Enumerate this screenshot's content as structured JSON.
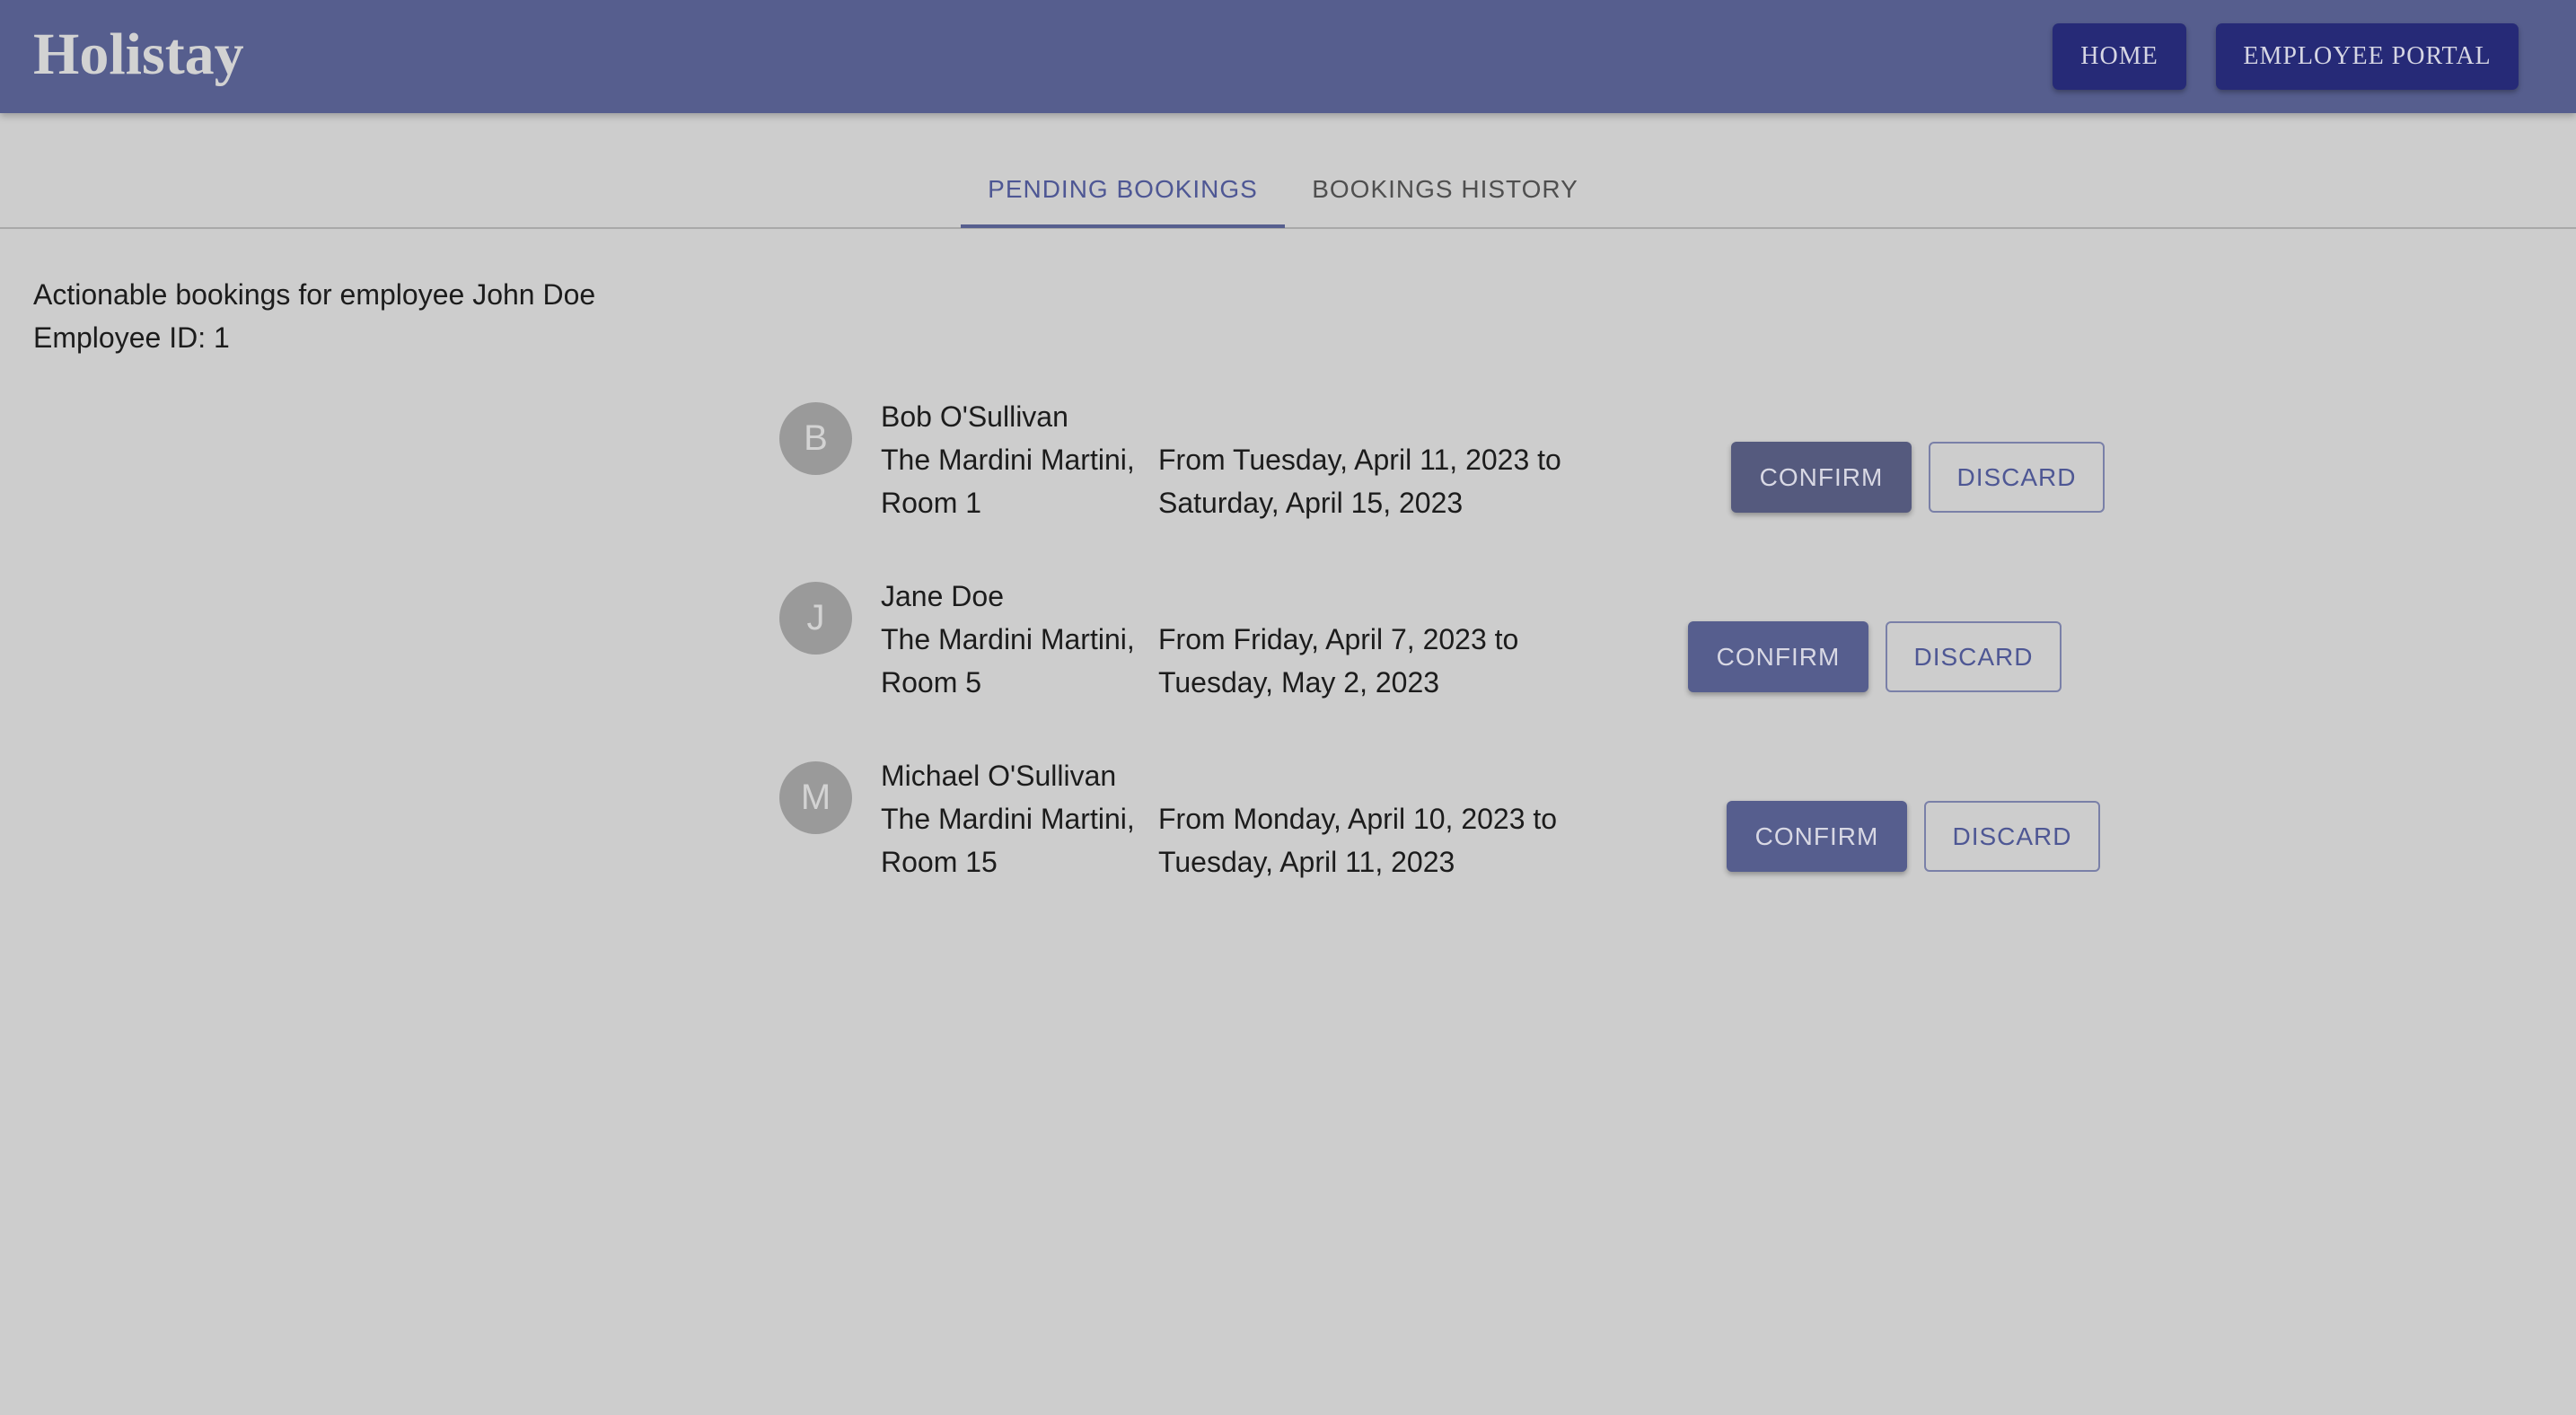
{
  "app": {
    "brand": "Holistay",
    "nav": {
      "home_label": "HOME",
      "employee_portal_label": "EMPLOYEE PORTAL"
    }
  },
  "tabs": [
    {
      "label": "PENDING BOOKINGS",
      "active": true
    },
    {
      "label": "BOOKINGS HISTORY",
      "active": false
    }
  ],
  "intro": {
    "heading": "Actionable bookings for employee John Doe",
    "employee_id": "Employee ID: 1"
  },
  "bookings": [
    {
      "initial": "B",
      "guest": "Bob O'Sullivan",
      "hotel": "The Mardini Martini, Room 1",
      "dates": "From Tuesday, April 11, 2023 to Saturday, April 15, 2023",
      "confirm_label": "CONFIRM",
      "discard_label": "DISCARD"
    },
    {
      "initial": "J",
      "guest": "Jane Doe",
      "hotel": "The Mardini Martini, Room 5",
      "dates": "From Friday, April 7, 2023 to Tuesday, May 2, 2023",
      "confirm_label": "CONFIRM",
      "discard_label": "DISCARD"
    },
    {
      "initial": "M",
      "guest": "Michael O'Sullivan",
      "hotel": "The Mardini Martini, Room 15",
      "dates": "From Monday, April 10, 2023 to Tuesday, April 11, 2023",
      "confirm_label": "CONFIRM",
      "discard_label": "DISCARD"
    }
  ],
  "colors": {
    "primary": "#565e8e",
    "nav_button": "#262a77",
    "background": "#cdcdcd",
    "avatar": "#9a9a9a"
  }
}
